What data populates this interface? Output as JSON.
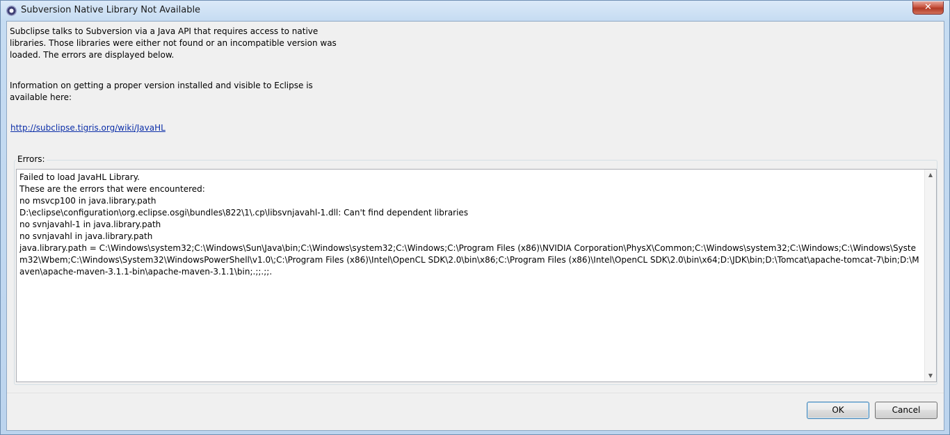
{
  "window": {
    "title": "Subversion Native Library Not Available",
    "close_label": "✕"
  },
  "message": {
    "paragraph1": "Subclipse talks to Subversion via a Java API that requires access to native libraries.  Those libraries were either not found or an incompatible version was loaded.  The errors are displayed below.",
    "paragraph2": "Information on getting a proper version installed and visible to Eclipse is available here:",
    "link": "http://subclipse.tigris.org/wiki/JavaHL"
  },
  "errors": {
    "label": "Errors:",
    "text": "Failed to load JavaHL Library.\nThese are the errors that were encountered:\nno msvcp100 in java.library.path\nD:\\eclipse\\configuration\\org.eclipse.osgi\\bundles\\822\\1\\.cp\\libsvnjavahl-1.dll: Can't find dependent libraries\nno svnjavahl-1 in java.library.path\nno svnjavahl in java.library.path\njava.library.path = C:\\Windows\\system32;C:\\Windows\\Sun\\Java\\bin;C:\\Windows\\system32;C:\\Windows;C:\\Program Files (x86)\\NVIDIA Corporation\\PhysX\\Common;C:\\Windows\\system32;C:\\Windows;C:\\Windows\\System32\\Wbem;C:\\Windows\\System32\\WindowsPowerShell\\v1.0\\;C:\\Program Files (x86)\\Intel\\OpenCL SDK\\2.0\\bin\\x86;C:\\Program Files (x86)\\Intel\\OpenCL SDK\\2.0\\bin\\x64;D:\\JDK\\bin;D:\\Tomcat\\apache-tomcat-7\\bin;D:\\Maven\\apache-maven-3.1.1-bin\\apache-maven-3.1.1\\bin;.;;.;;."
  },
  "buttons": {
    "ok": "OK",
    "cancel": "Cancel"
  },
  "colors": {
    "link": "#0b2ea8",
    "close_button": "#c7533f",
    "default_button_border": "#3c7fb1"
  },
  "icons": {
    "app": "subclipse-app-icon",
    "close": "close-icon",
    "scroll_up": "scroll-up-arrow-icon",
    "scroll_down": "scroll-down-arrow-icon"
  }
}
